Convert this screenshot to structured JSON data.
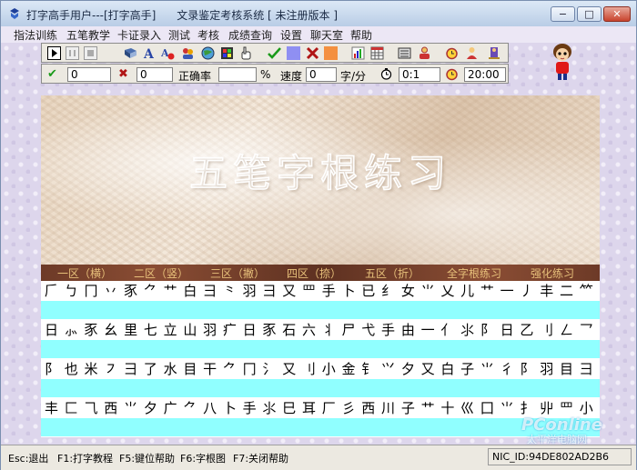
{
  "window": {
    "title": "打字高手用户---[打字高手]      文录鉴定考核系统 [ 未注册版本 ]",
    "minimize_glyph": "−",
    "maximize_glyph": "□",
    "close_glyph": "✕"
  },
  "menu": [
    "指法训练",
    "五笔教学",
    "卡证录入",
    "测试",
    "考核",
    "成绩查询",
    "设置",
    "聊天室",
    "帮助"
  ],
  "toolbar": {
    "icons": [
      "play-icon",
      "pause-icon",
      "stop-icon",
      "book-icon",
      "font-icon",
      "text-settings-icon",
      "people-icon",
      "globe-icon",
      "film-icon",
      "hand-pointer-icon",
      "checkmark-icon",
      "blue-square-icon",
      "cross-icon",
      "orange-square-icon",
      "bar-chart-icon",
      "table-icon",
      "keyboard-icon",
      "users-icon",
      "alarm-clock-icon",
      "person-icon",
      "exit-icon"
    ]
  },
  "stats": {
    "correct_count": "0",
    "wrong_count": "0",
    "accuracy_label": "正确率",
    "accuracy_value": "",
    "percent_unit": "%",
    "speed_label": "速度",
    "speed_value": "0",
    "speed_unit": "字/分",
    "elapsed_time": "0:1",
    "time_limit": "20:00"
  },
  "banner": {
    "title": "五笔字根练习"
  },
  "tabs": [
    "一区（横）",
    "二区（竖）",
    "三区（撇）",
    "四区（捺）",
    "五区（折）",
    "全字根练习",
    "强化练习"
  ],
  "practice_lines": [
    "𠂆 ㄅ 冂 丷 豕 ⺈ 艹 白 ⺕ ⺀ 羽 彐 又 罒 手 卜 已 纟 女 ⺌ 乂 儿 艹 一 丿 丰 二 ⺮ 尸 乚 ⺼ 米 皿",
    "日 ⺗ 豕 ⺓ 里 七 立 山 羽 疒 日 豕 石 六 丬 尸 弋 手 由 一 亻 ⺢ 阝 日 乙 刂 ㄥ 乛 ㇏ 言 氵 七 儿 币",
    "阝 也 米 ㇇ ⺕ 了 水 目 干 ⺈ 冂 氵 又 刂 小 金 钅 ⺍ 夕 又 白 子 ⺌ 彳 阝 羽 目 彐 贝 厂 弋 一 方 水",
    "丰 匚 ⺄ 西 ⺌ 夕 广 ⺈ 八 卜 手 ⺢ 巳 耳 厂 彡 西 川 子 艹 十 巛 囗 ⺌ 扌 丱 罒 小 艹 虫 月 丬 八 米"
  ],
  "status": {
    "items": [
      "Esc:退出",
      "F1:打字教程",
      "F5:键位帮助",
      "F6:字根图",
      "F7:关闭帮助"
    ],
    "nic": "NIC_ID:94DE802AD2B6"
  },
  "watermark": {
    "brand": "PConline",
    "sub": "太平洋电脑网"
  },
  "colors": {
    "practice_band": "#90ffff",
    "tab_text": "#e7c07a",
    "tab_bar": "#6d3a27"
  }
}
